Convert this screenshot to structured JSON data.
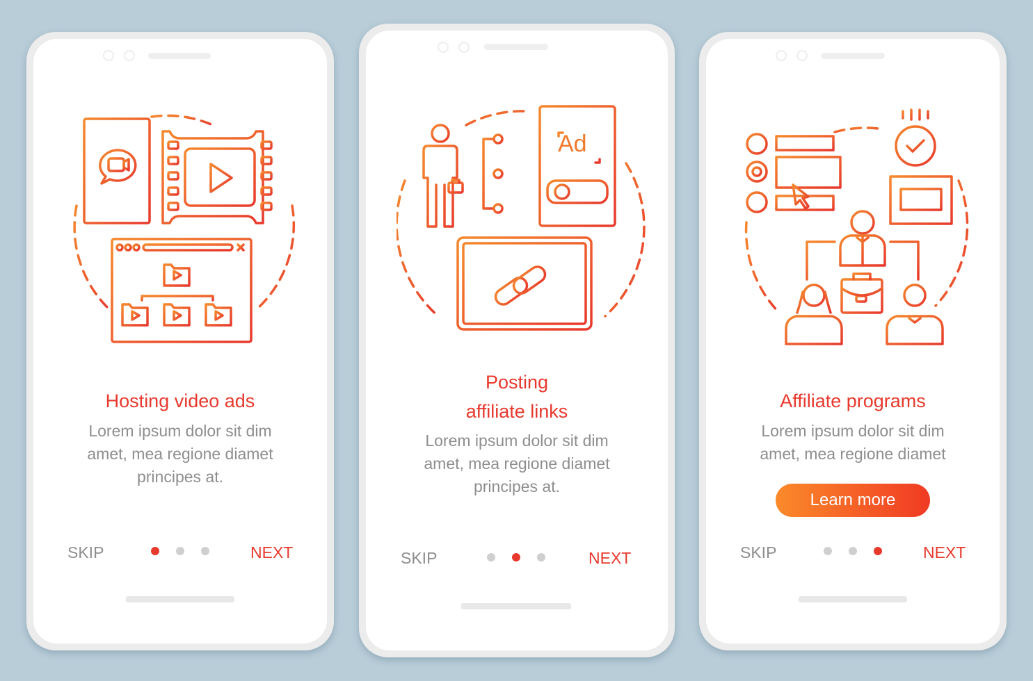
{
  "colors": {
    "accent": "#e8392d",
    "gradient_start": "#f5892e",
    "gradient_end": "#e8392d",
    "muted_text": "#8e8e8e",
    "background": "#b8cdd8"
  },
  "screens": [
    {
      "title": "Hosting  video ads",
      "description": [
        "Lorem ipsum dolor sit dim",
        "amet, mea regione diamet",
        "principes at."
      ],
      "illustration": "video-hosting-icon",
      "skip_label": "SKIP",
      "next_label": "NEXT",
      "page_indicator": {
        "current": 1,
        "total": 3
      }
    },
    {
      "title_lines": [
        "Posting",
        "affiliate links"
      ],
      "description": [
        "Lorem ipsum dolor sit dim",
        "amet, mea regione diamet",
        "principes at."
      ],
      "illustration": "affiliate-links-icon",
      "ad_label": "Ad",
      "skip_label": "SKIP",
      "next_label": "NEXT",
      "page_indicator": {
        "current": 2,
        "total": 3
      }
    },
    {
      "title": "Affiliate programs",
      "description": [
        "Lorem ipsum dolor sit dim",
        "amet, mea regione diamet"
      ],
      "illustration": "affiliate-programs-icon",
      "button_label": "Learn more",
      "skip_label": "SKIP",
      "next_label": "NEXT",
      "page_indicator": {
        "current": 3,
        "total": 3
      }
    }
  ]
}
